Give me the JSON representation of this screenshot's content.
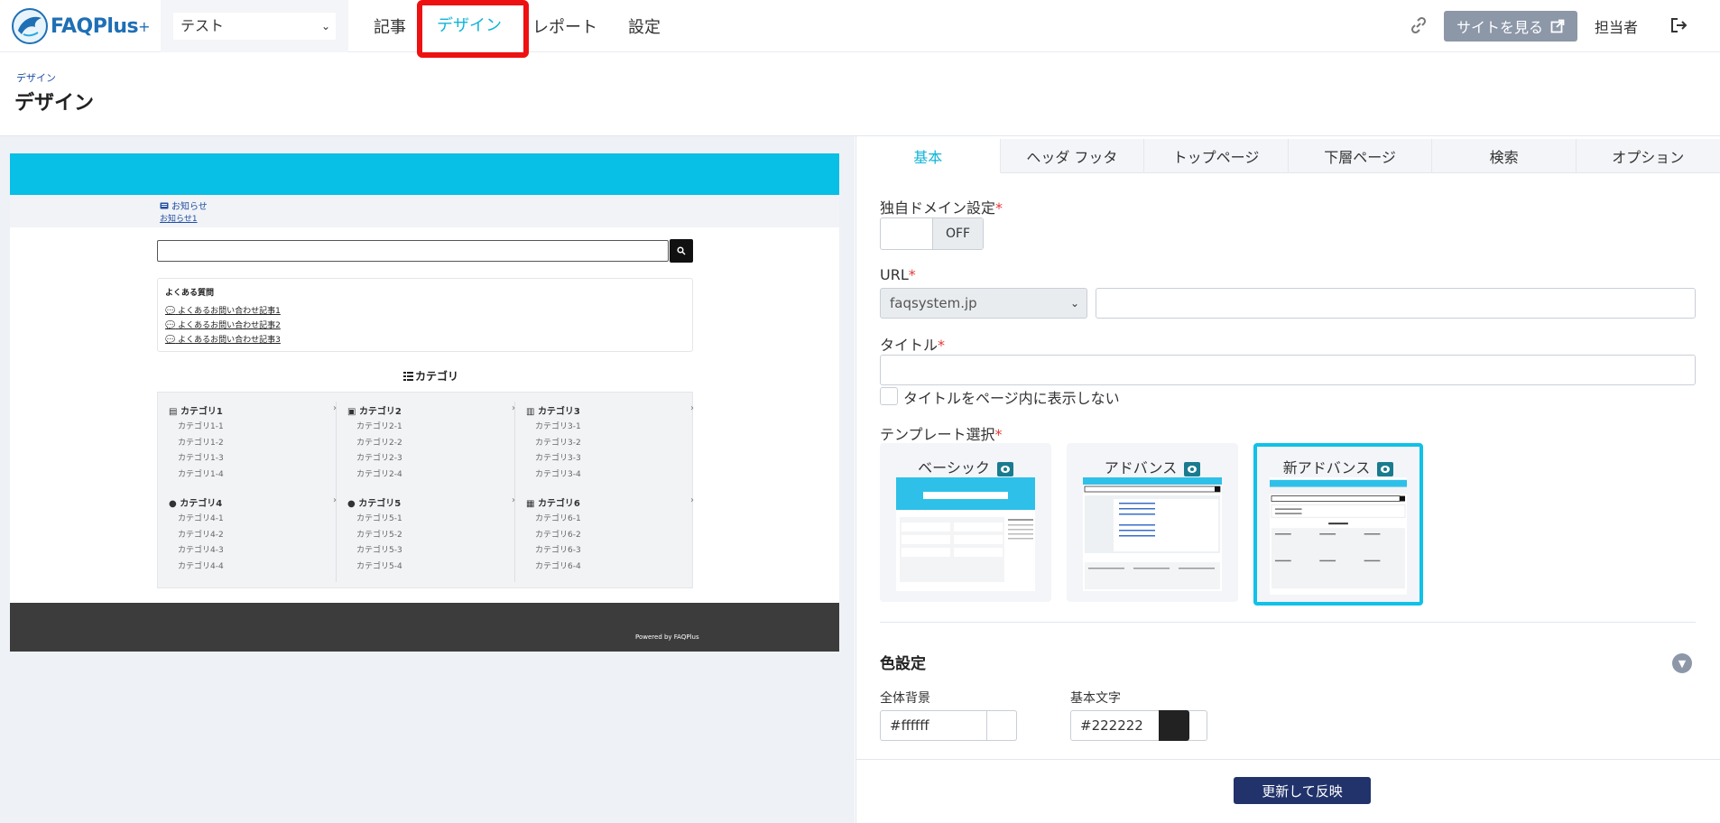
{
  "app": {
    "logo_text": "FAQPlus",
    "logo_plus": "+",
    "site_select_value": "テスト"
  },
  "nav": {
    "articles": "記事",
    "design": "デザイン",
    "report": "レポート",
    "settings": "設定"
  },
  "topright": {
    "view_site": "サイトを見る",
    "staff": "担当者"
  },
  "page": {
    "breadcrumb": "デザイン",
    "title": "デザイン"
  },
  "preview": {
    "notice_title": "お知らせ",
    "notice_link": "お知らせ1",
    "faq_title": "よくある質問",
    "faq_items": [
      "よくあるお問い合わせ記事1",
      "よくあるお問い合わせ記事2",
      "よくあるお問い合わせ記事3"
    ],
    "category_heading": "カテゴリ",
    "categories": [
      {
        "name": "カテゴリ1",
        "subs": [
          "カテゴリ1-1",
          "カテゴリ1-2",
          "カテゴリ1-3",
          "カテゴリ1-4"
        ]
      },
      {
        "name": "カテゴリ2",
        "subs": [
          "カテゴリ2-1",
          "カテゴリ2-2",
          "カテゴリ2-3",
          "カテゴリ2-4"
        ]
      },
      {
        "name": "カテゴリ3",
        "subs": [
          "カテゴリ3-1",
          "カテゴリ3-2",
          "カテゴリ3-3",
          "カテゴリ3-4"
        ]
      },
      {
        "name": "カテゴリ4",
        "subs": [
          "カテゴリ4-1",
          "カテゴリ4-2",
          "カテゴリ4-3",
          "カテゴリ4-4"
        ]
      },
      {
        "name": "カテゴリ5",
        "subs": [
          "カテゴリ5-1",
          "カテゴリ5-2",
          "カテゴリ5-3",
          "カテゴリ5-4"
        ]
      },
      {
        "name": "カテゴリ6",
        "subs": [
          "カテゴリ6-1",
          "カテゴリ6-2",
          "カテゴリ6-3",
          "カテゴリ6-4"
        ]
      }
    ],
    "powered_by": "Powered by FAQPlus",
    "header_color": "#08bfe6",
    "footer_color": "#3c3c3c"
  },
  "tabs": [
    "基本",
    "ヘッダ フッタ",
    "トップページ",
    "下層ページ",
    "検索",
    "オプション"
  ],
  "form": {
    "domain_label": "独自ドメイン設定",
    "toggle_value": "OFF",
    "url_label": "URL",
    "domain_select_value": "faqsystem.jp",
    "url_value": "",
    "title_label": "タイトル",
    "title_value": "",
    "hide_title_label": "タイトルをページ内に表示しない",
    "template_label": "テンプレート選択",
    "required_mark": "*",
    "templates": [
      "ベーシック",
      "アドバンス",
      "新アドバンス"
    ],
    "color_section": "色設定",
    "bg_label": "全体背景",
    "bg_value": "#ffffff",
    "text_label": "基本文字",
    "text_value": "#222222",
    "apply_button": "更新して反映"
  },
  "colors": {
    "accent": "#10b4d8",
    "primary_button": "#22336b",
    "highlight_box": "#ee1111"
  }
}
